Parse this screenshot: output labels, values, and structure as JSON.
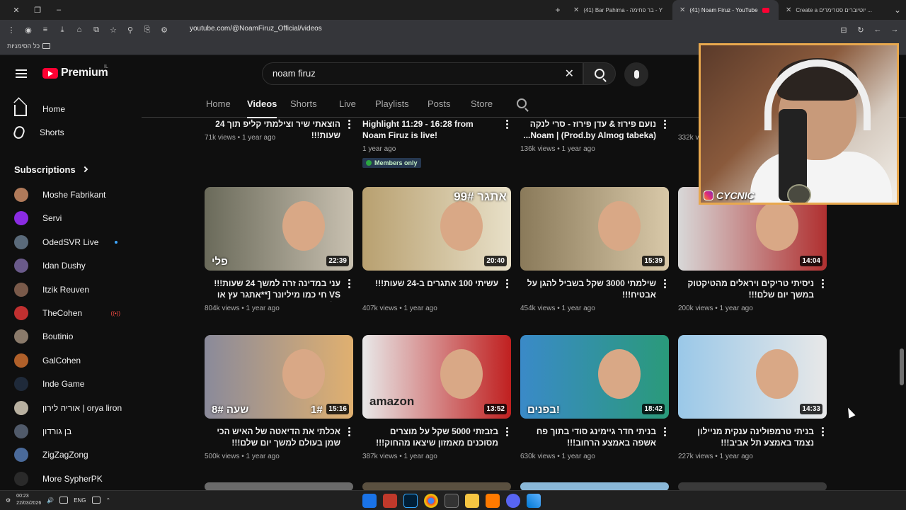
{
  "browser": {
    "tabs": [
      {
        "label": "(41) Bar Pahima - בר פחימה - Y",
        "active": false
      },
      {
        "label": "(41) Noam Firuz - YouTube",
        "active": true
      },
      {
        "label": "Create a יוטיוברים סטרימרים ...",
        "active": false
      }
    ],
    "url": "youtube.com/@NoamFiruz_Official/videos",
    "bookmarks_folder": "כל הסימניות"
  },
  "youtube": {
    "logo_text": "Premium",
    "country_code": "IL",
    "search_query": "noam firuz",
    "sidebar": {
      "home": "Home",
      "shorts": "Shorts",
      "subscriptions_heading": "Subscriptions",
      "subscriptions": [
        {
          "name": "Moshe Fabrikant",
          "color": "#b07a5a"
        },
        {
          "name": "Servi",
          "color": "#8a2be2"
        },
        {
          "name": "OdedSVR Live",
          "color": "#5a6a7a",
          "dot": true
        },
        {
          "name": "Idan Dushy",
          "color": "#6a5a8a"
        },
        {
          "name": "Itzik Reuven",
          "color": "#7a5a4a"
        },
        {
          "name": "TheCohen",
          "color": "#c03030",
          "live": "((•))"
        },
        {
          "name": "Boutinio",
          "color": "#8a7a6a"
        },
        {
          "name": "GalCohen",
          "color": "#b0602a"
        },
        {
          "name": "Inde Game",
          "color": "#1f2a3a"
        },
        {
          "name": "אוריה לירון | orya liron",
          "color": "#b8b0a0"
        },
        {
          "name": "בן גורדון",
          "color": "#505a6a"
        },
        {
          "name": "ZigZagZong",
          "color": "#4a6a9a"
        },
        {
          "name": "More SypherPK",
          "color": "#2a2a2a"
        }
      ]
    },
    "channel_tabs": [
      "Home",
      "Videos",
      "Shorts",
      "Live",
      "Playlists",
      "Posts",
      "Store"
    ],
    "active_tab": "Videos",
    "videos_row0": [
      {
        "title": "הוצאתי שיר וצילמתי קליפ תוך 24 שעות!!!",
        "views": "71k views",
        "age": "1 year ago"
      },
      {
        "title": "Highlight 11:29 - 16:28 from Noam Firuz is live!",
        "views": "",
        "age": "1 year ago",
        "badge": "Members only"
      },
      {
        "title": "נועם פירוז & עדן פירוז - סרי לנקה (Prod.by Almog tabeka) | Noam...",
        "views": "136k views",
        "age": "1 year ago"
      },
      {
        "title": "...ה ב-1 שקל!!!",
        "views": "332k views",
        "age": "1 year ago"
      }
    ],
    "videos_row1": [
      {
        "title": "עני במדינה זרה למשך 24 שעות!!! VS חי כמו מיליונר [**אתגר עץ או פלי**]",
        "views": "804k views",
        "age": "1 year ago",
        "duration": "22:39",
        "overlay": "פלי",
        "thumb": [
          "#6a6a5a",
          "#c8c0b0"
        ]
      },
      {
        "title": "עשיתי 100 אתגרים ב-24 שעות!!!",
        "views": "407k views",
        "age": "1 year ago",
        "duration": "20:40",
        "overlay": "אתגר 99#",
        "thumb": [
          "#b8a070",
          "#e8e0c8"
        ]
      },
      {
        "title": "שילמתי 3000 שקל בשביל להגן על אבטיח!!!",
        "views": "454k views",
        "age": "1 year ago",
        "duration": "15:39",
        "thumb": [
          "#8a7a5a",
          "#d8c8a8"
        ]
      },
      {
        "title": "ניסיתי טריקים ויראלים מהטיקטוק במשך יום שלם!!!",
        "views": "200k views",
        "age": "1 year ago",
        "duration": "14:04",
        "thumb": [
          "#d8d8d8",
          "#b03030"
        ]
      }
    ],
    "videos_row2": [
      {
        "title": "אכלתי את הדיאטה של האיש הכי שמן בעולם למשך יום שלם!!! [30,000**...",
        "views": "500k views",
        "age": "1 year ago",
        "duration": "15:16",
        "overlay": "שעה 8#",
        "overlay2": "1#",
        "thumb": [
          "#8a8a9a",
          "#e0b070"
        ]
      },
      {
        "title": "בזבזתי 5000 שקל על מוצרים מסוכנים מאמזון שיצאו מהחוק!!!",
        "views": "387k views",
        "age": "1 year ago",
        "duration": "13:52",
        "overlay": "amazon",
        "thumb": [
          "#e8e8e8",
          "#c02020"
        ]
      },
      {
        "title": "בניתי חדר גיימינג סודי בתוך פח אשפה באמצע הרחוב!!!",
        "views": "630k views",
        "age": "1 year ago",
        "duration": "18:42",
        "overlay": "בפנים!",
        "thumb": [
          "#3a8ac8",
          "#2a9a7a"
        ]
      },
      {
        "title": "בניתי טרמפולינה ענקית מניילון נצמד באמצע תל אביב!!!",
        "views": "227k views",
        "age": "1 year ago",
        "duration": "14:33",
        "thumb": [
          "#9ac8e8",
          "#e8e8e8"
        ]
      }
    ]
  },
  "webcam": {
    "handle": "CYCNIC"
  },
  "taskbar": {
    "time": "00:23",
    "date": "22/03/2026",
    "lang": "ENG"
  }
}
